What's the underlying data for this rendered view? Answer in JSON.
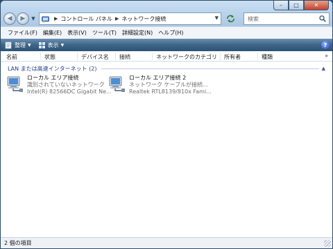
{
  "window": {
    "caption_buttons": {
      "minimize": "–",
      "maximize": "□",
      "close": "✕"
    }
  },
  "navigation": {
    "back": "◀",
    "forward": "▶",
    "breadcrumbs": [
      "コントロール パネル",
      "ネットワーク接続"
    ],
    "search_placeholder": "検索"
  },
  "menubar": {
    "items": [
      {
        "label": "ファイル(F)"
      },
      {
        "label": "編集(E)"
      },
      {
        "label": "表示(V)"
      },
      {
        "label": "ツール(T)"
      },
      {
        "label": "詳細設定(N)"
      },
      {
        "label": "ヘルプ(H)"
      }
    ]
  },
  "commandbar": {
    "organize": "整理",
    "views": "表示",
    "help": "?"
  },
  "columns": [
    "名前",
    "状態",
    "デバイス名",
    "接続",
    "ネットワークのカテゴリ",
    "所有者",
    "種類"
  ],
  "columns_more": "»",
  "group": {
    "label": "LAN または高速インターネット (2)"
  },
  "connections": [
    {
      "name": "ローカル エリア接続",
      "status": "識別されていないネットワーク",
      "device": "Intel(R) 82566DC Gigabit Ne..."
    },
    {
      "name": "ローカル エリア接続 2",
      "status": "ネットワーク ケーブルが接続...",
      "device": "Realtek RTL8139/810x Fami..."
    }
  ],
  "statusbar": {
    "text": "2 個の項目"
  },
  "colors": {
    "command_bar": "#3e6486",
    "group_label": "#1e3f8a",
    "chrome": "#bcd3ea"
  }
}
